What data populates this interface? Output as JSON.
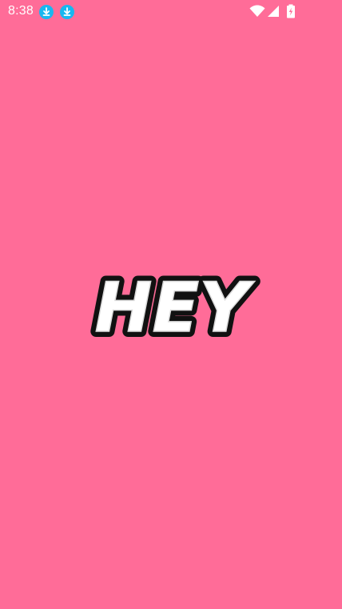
{
  "status_bar": {
    "time": "8:38",
    "notifications": [
      "download-icon",
      "download-icon"
    ],
    "icons": [
      "wifi-icon",
      "cell-signal-icon",
      "battery-charging-icon"
    ]
  },
  "splash": {
    "logo_text": "HEY"
  },
  "colors": {
    "background": "#FF6C98",
    "notification_badge": "#18B7F0",
    "logo_fill": "#FFFFFF",
    "logo_outline": "#111111"
  }
}
